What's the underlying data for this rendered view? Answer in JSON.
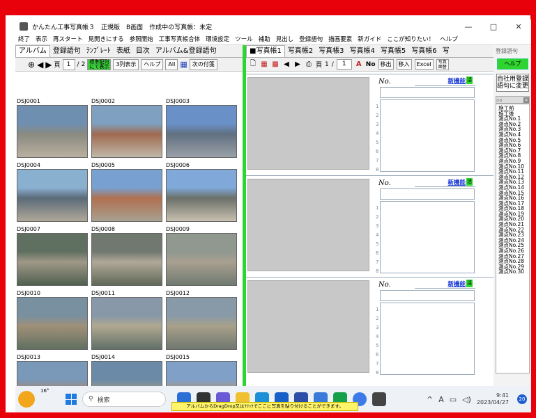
{
  "window": {
    "title": "かんたん工事写真帳３　正規版　B画面　作成中の写真帳：未定",
    "minimize": "—",
    "maximize": "□",
    "close": "✕"
  },
  "menu": [
    "終了",
    "表示",
    "再スタート",
    "見開きにする",
    "参照開始",
    "工事写真帳合体",
    "環境設定",
    "ツール",
    "補助",
    "見出し",
    "登録語句",
    "描画要素",
    "新ガイド",
    "ここが知りたい！",
    "ヘルプ"
  ],
  "album": {
    "tabs": [
      "アルバム",
      "登録語句",
      "ﾃﾝﾌﾟﾚｰﾄ",
      "表紙",
      "目次",
      "アルバム&登録語句"
    ],
    "active_tab": 0,
    "toolbar": {
      "page_prefix": "頁",
      "page_value": "1",
      "page_sep": "/",
      "page_total": "2",
      "green_btn_line1": "標準配列",
      "green_btn_line2": "にて表示",
      "columns_select": "3列表示",
      "help": "ヘルプ",
      "all": "All",
      "next_tag": "次の付箋"
    },
    "photos": [
      "DSJ0001",
      "DSJ0002",
      "DSJ0003",
      "DSJ0004",
      "DSJ0005",
      "DSJ0006",
      "DSJ0007",
      "DSJ0008",
      "DSJ0009",
      "DSJ0010",
      "DSJ0011",
      "DSJ0012",
      "DSJ0013",
      "DSJ0014",
      "DSJ0015"
    ]
  },
  "book": {
    "tabs": [
      "■写真帳1",
      "写真帳2",
      "写真帳3",
      "写真帳4",
      "写真帳5",
      "写真帳6",
      "写"
    ],
    "toolbar": {
      "page_prefix": "頁",
      "page_value": "1",
      "page_sep": "/",
      "page_total": "1",
      "no_label": "No",
      "move_out": "移出",
      "move_in": "移入",
      "excel": "Excel",
      "photo_face": "写真面替"
    },
    "slot": {
      "no_label": "No.",
      "new_feature": "新機能",
      "tag": "活",
      "line_numbers": [
        "1",
        "2",
        "3",
        "4",
        "5",
        "6",
        "7",
        "8"
      ]
    }
  },
  "words": {
    "header": "登録語句",
    "help": "ヘルプ",
    "register_line1": "自社用登録",
    "register_line2": "語句に変更",
    "list_title": "aa",
    "items": [
      "施工前",
      "施工後",
      "測点No.1",
      "測点No.2",
      "測点No.3",
      "測点No.4",
      "測点No.5",
      "測点No.6",
      "測点No.7",
      "測点No.8",
      "測点No.9",
      "測点No.10",
      "測点No.11",
      "測点No.12",
      "測点No.13",
      "測点No.14",
      "測点No.15",
      "測点No.16",
      "測点No.17",
      "測点No.18",
      "測点No.19",
      "測点No.20",
      "測点No.21",
      "測点No.22",
      "測点No.23",
      "測点No.24",
      "測点No.25",
      "測点No.26",
      "測点No.27",
      "測点No.28",
      "測点No.29",
      "測点No.30"
    ]
  },
  "taskbar": {
    "temperature": "16°",
    "search_placeholder": "検索",
    "time": "9:41",
    "date": "2023/04/27",
    "notifications": "20",
    "ime": "A"
  },
  "tooltip": "アルバムからDragDrop又はｸﾘｯｸでここに写真を貼り付けることができます。",
  "colors": {
    "frame": "#e8000b",
    "accent_green": "#2fd52f",
    "link_blue": "#1a3bd6"
  }
}
